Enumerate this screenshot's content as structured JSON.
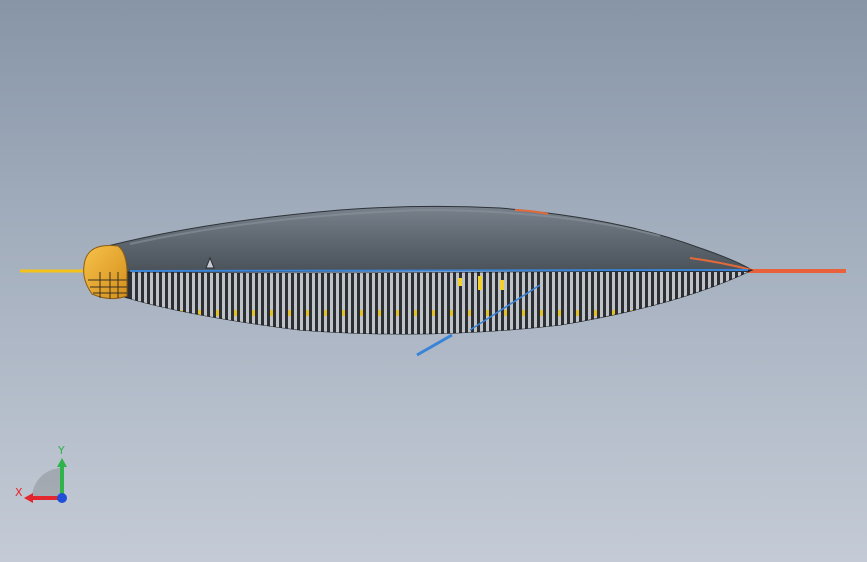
{
  "viewport": {
    "background_top": "#8795a7",
    "background_bottom": "#c4cbd6"
  },
  "model": {
    "hull_color": "#5e6770",
    "frame_color": "#3b3f44",
    "nose_cap_color": "#f0b030",
    "front_rod_color": "#f3c31a",
    "rear_rod_color": "#e8613a",
    "blue_member_color": "#3a84d8"
  },
  "triad": {
    "x_label": "X",
    "y_label": "Y",
    "x_color": "#e3252d",
    "y_color": "#2fb34a",
    "z_color": "#1f4fd8"
  }
}
